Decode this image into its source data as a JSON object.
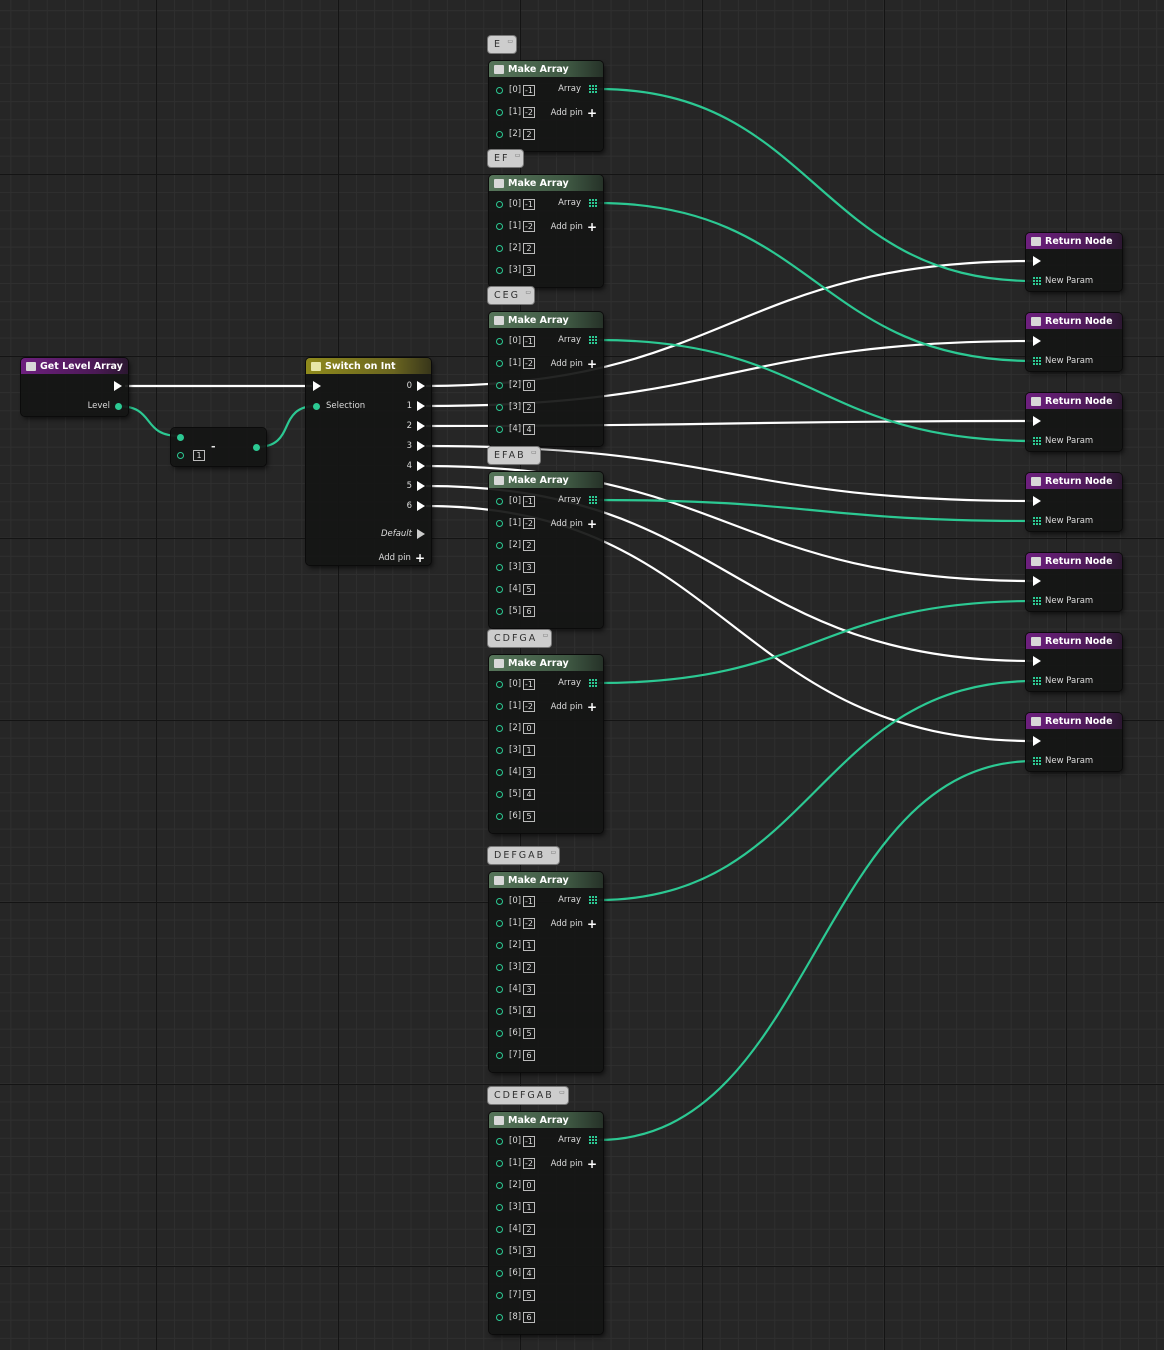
{
  "get_level": {
    "title": "Get Level Array",
    "level_label": "Level"
  },
  "minus": {
    "op": "-",
    "value": "1"
  },
  "switch": {
    "title": "Switch on Int",
    "selection_label": "Selection",
    "outputs": [
      "0",
      "1",
      "2",
      "3",
      "4",
      "5",
      "6"
    ],
    "default_label": "Default",
    "add_pin_label": "Add pin"
  },
  "make_array_title": "Make Array",
  "array_label": "Array",
  "add_pin_label": "Add pin",
  "arrays": [
    {
      "comment": "E",
      "items": [
        [
          "[0]",
          "-1"
        ],
        [
          "[1]",
          "-2"
        ],
        [
          "[2]",
          "2"
        ]
      ]
    },
    {
      "comment": "EF",
      "items": [
        [
          "[0]",
          "-1"
        ],
        [
          "[1]",
          "-2"
        ],
        [
          "[2]",
          "2"
        ],
        [
          "[3]",
          "3"
        ]
      ]
    },
    {
      "comment": "CEG",
      "items": [
        [
          "[0]",
          "-1"
        ],
        [
          "[1]",
          "-2"
        ],
        [
          "[2]",
          "0"
        ],
        [
          "[3]",
          "2"
        ],
        [
          "[4]",
          "4"
        ]
      ]
    },
    {
      "comment": "EFAB",
      "items": [
        [
          "[0]",
          "-1"
        ],
        [
          "[1]",
          "-2"
        ],
        [
          "[2]",
          "2"
        ],
        [
          "[3]",
          "3"
        ],
        [
          "[4]",
          "5"
        ],
        [
          "[5]",
          "6"
        ]
      ]
    },
    {
      "comment": "CDFGA",
      "items": [
        [
          "[0]",
          "-1"
        ],
        [
          "[1]",
          "-2"
        ],
        [
          "[2]",
          "0"
        ],
        [
          "[3]",
          "1"
        ],
        [
          "[4]",
          "3"
        ],
        [
          "[5]",
          "4"
        ],
        [
          "[6]",
          "5"
        ]
      ]
    },
    {
      "comment": "DEFGAB",
      "items": [
        [
          "[0]",
          "-1"
        ],
        [
          "[1]",
          "-2"
        ],
        [
          "[2]",
          "1"
        ],
        [
          "[3]",
          "2"
        ],
        [
          "[4]",
          "3"
        ],
        [
          "[5]",
          "4"
        ],
        [
          "[6]",
          "5"
        ],
        [
          "[7]",
          "6"
        ]
      ]
    },
    {
      "comment": "CDEFGAB",
      "items": [
        [
          "[0]",
          "-1"
        ],
        [
          "[1]",
          "-2"
        ],
        [
          "[2]",
          "0"
        ],
        [
          "[3]",
          "1"
        ],
        [
          "[4]",
          "2"
        ],
        [
          "[5]",
          "3"
        ],
        [
          "[6]",
          "4"
        ],
        [
          "[7]",
          "5"
        ],
        [
          "[8]",
          "6"
        ]
      ]
    }
  ],
  "return_node": {
    "title": "Return Node",
    "param_label": "New Param"
  },
  "colors": {
    "exec_wire": "#ffffff",
    "data_wire": "#2cc993",
    "header_purple": "#6d1f7e",
    "header_green": "#56755a",
    "header_yellow": "#8f8a1c"
  }
}
